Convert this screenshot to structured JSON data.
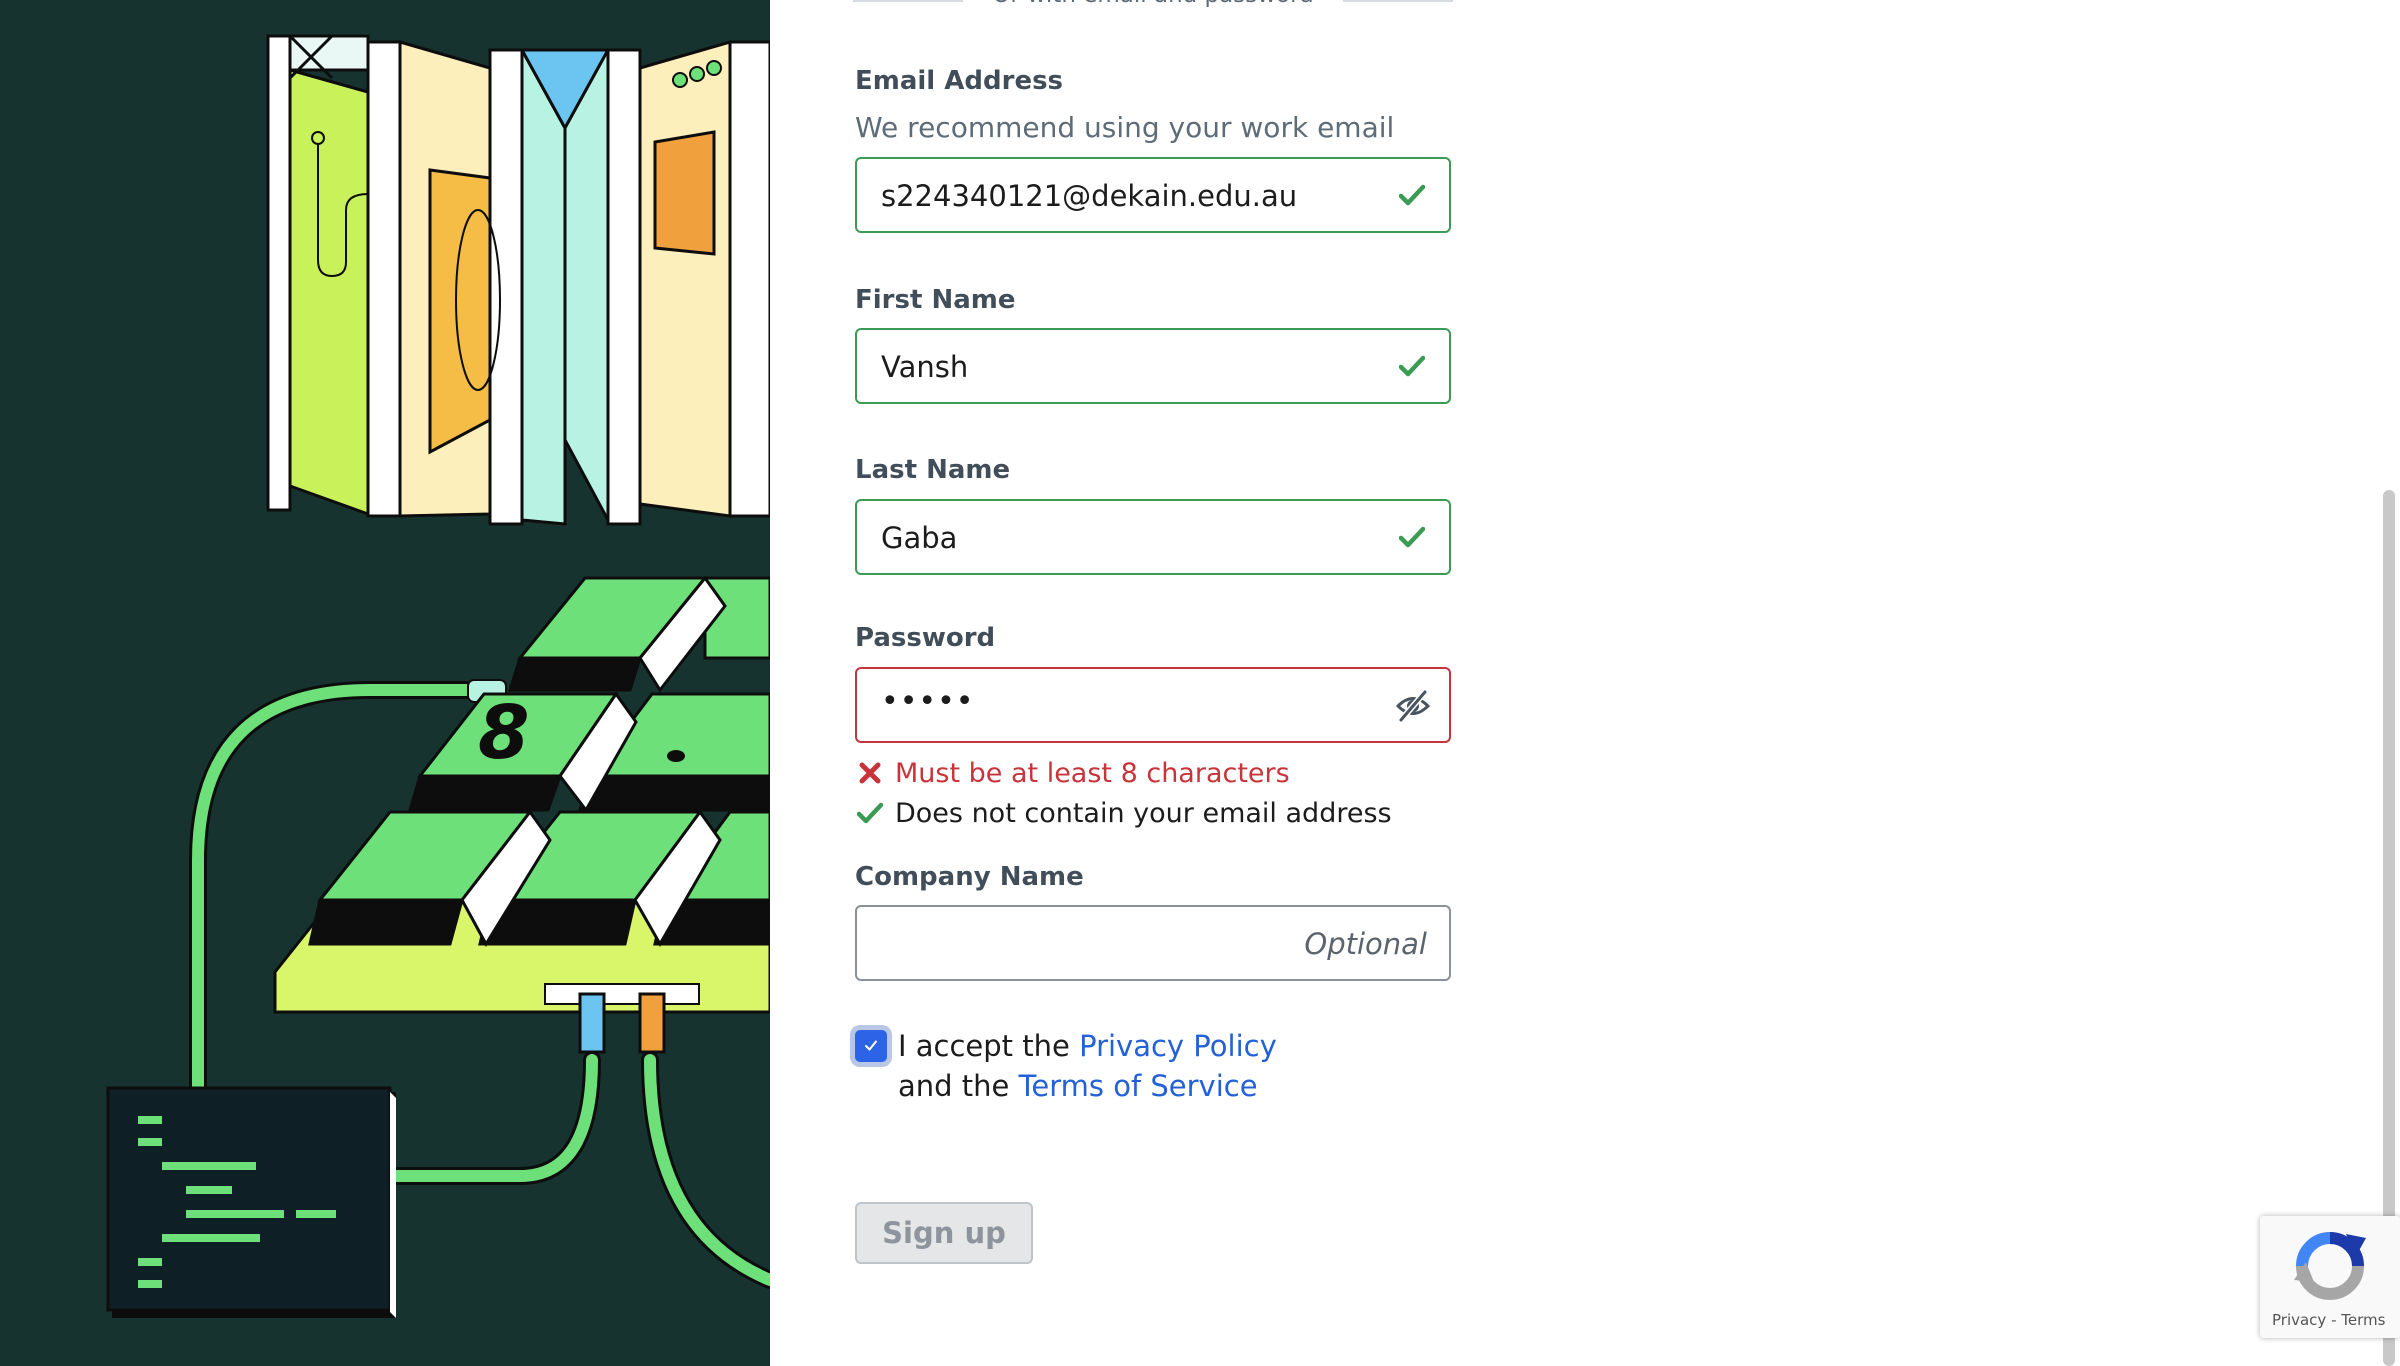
{
  "divider": {
    "text": "Or with email and password"
  },
  "email": {
    "label": "Email Address",
    "hint": "We recommend using your work email",
    "value": "s224340121@dekain.edu.au",
    "status_icon": "check-icon"
  },
  "first_name": {
    "label": "First Name",
    "value": "Vansh",
    "status_icon": "check-icon"
  },
  "last_name": {
    "label": "Last Name",
    "value": "Gaba",
    "status_icon": "check-icon"
  },
  "password": {
    "label": "Password",
    "masked_value": "•••••",
    "toggle_icon": "eye-slash-icon",
    "rules": [
      {
        "text": "Must be at least 8 characters",
        "status": "error"
      },
      {
        "text": "Does not contain your email address",
        "status": "ok"
      }
    ]
  },
  "company": {
    "label": "Company Name",
    "placeholder": "Optional"
  },
  "consent": {
    "checked": true,
    "prefix": "I accept the",
    "privacy_link": "Privacy Policy",
    "middle": "and the",
    "terms_link": "Terms of Service"
  },
  "signup": {
    "label": "Sign up"
  },
  "recaptcha": {
    "privacy": "Privacy",
    "separator": "-",
    "terms": "Terms"
  },
  "colors": {
    "valid": "#3b9b55",
    "error": "#c5353f",
    "link": "#2460d6",
    "checkbox": "#2d63e6",
    "art_bg": "#173330"
  }
}
